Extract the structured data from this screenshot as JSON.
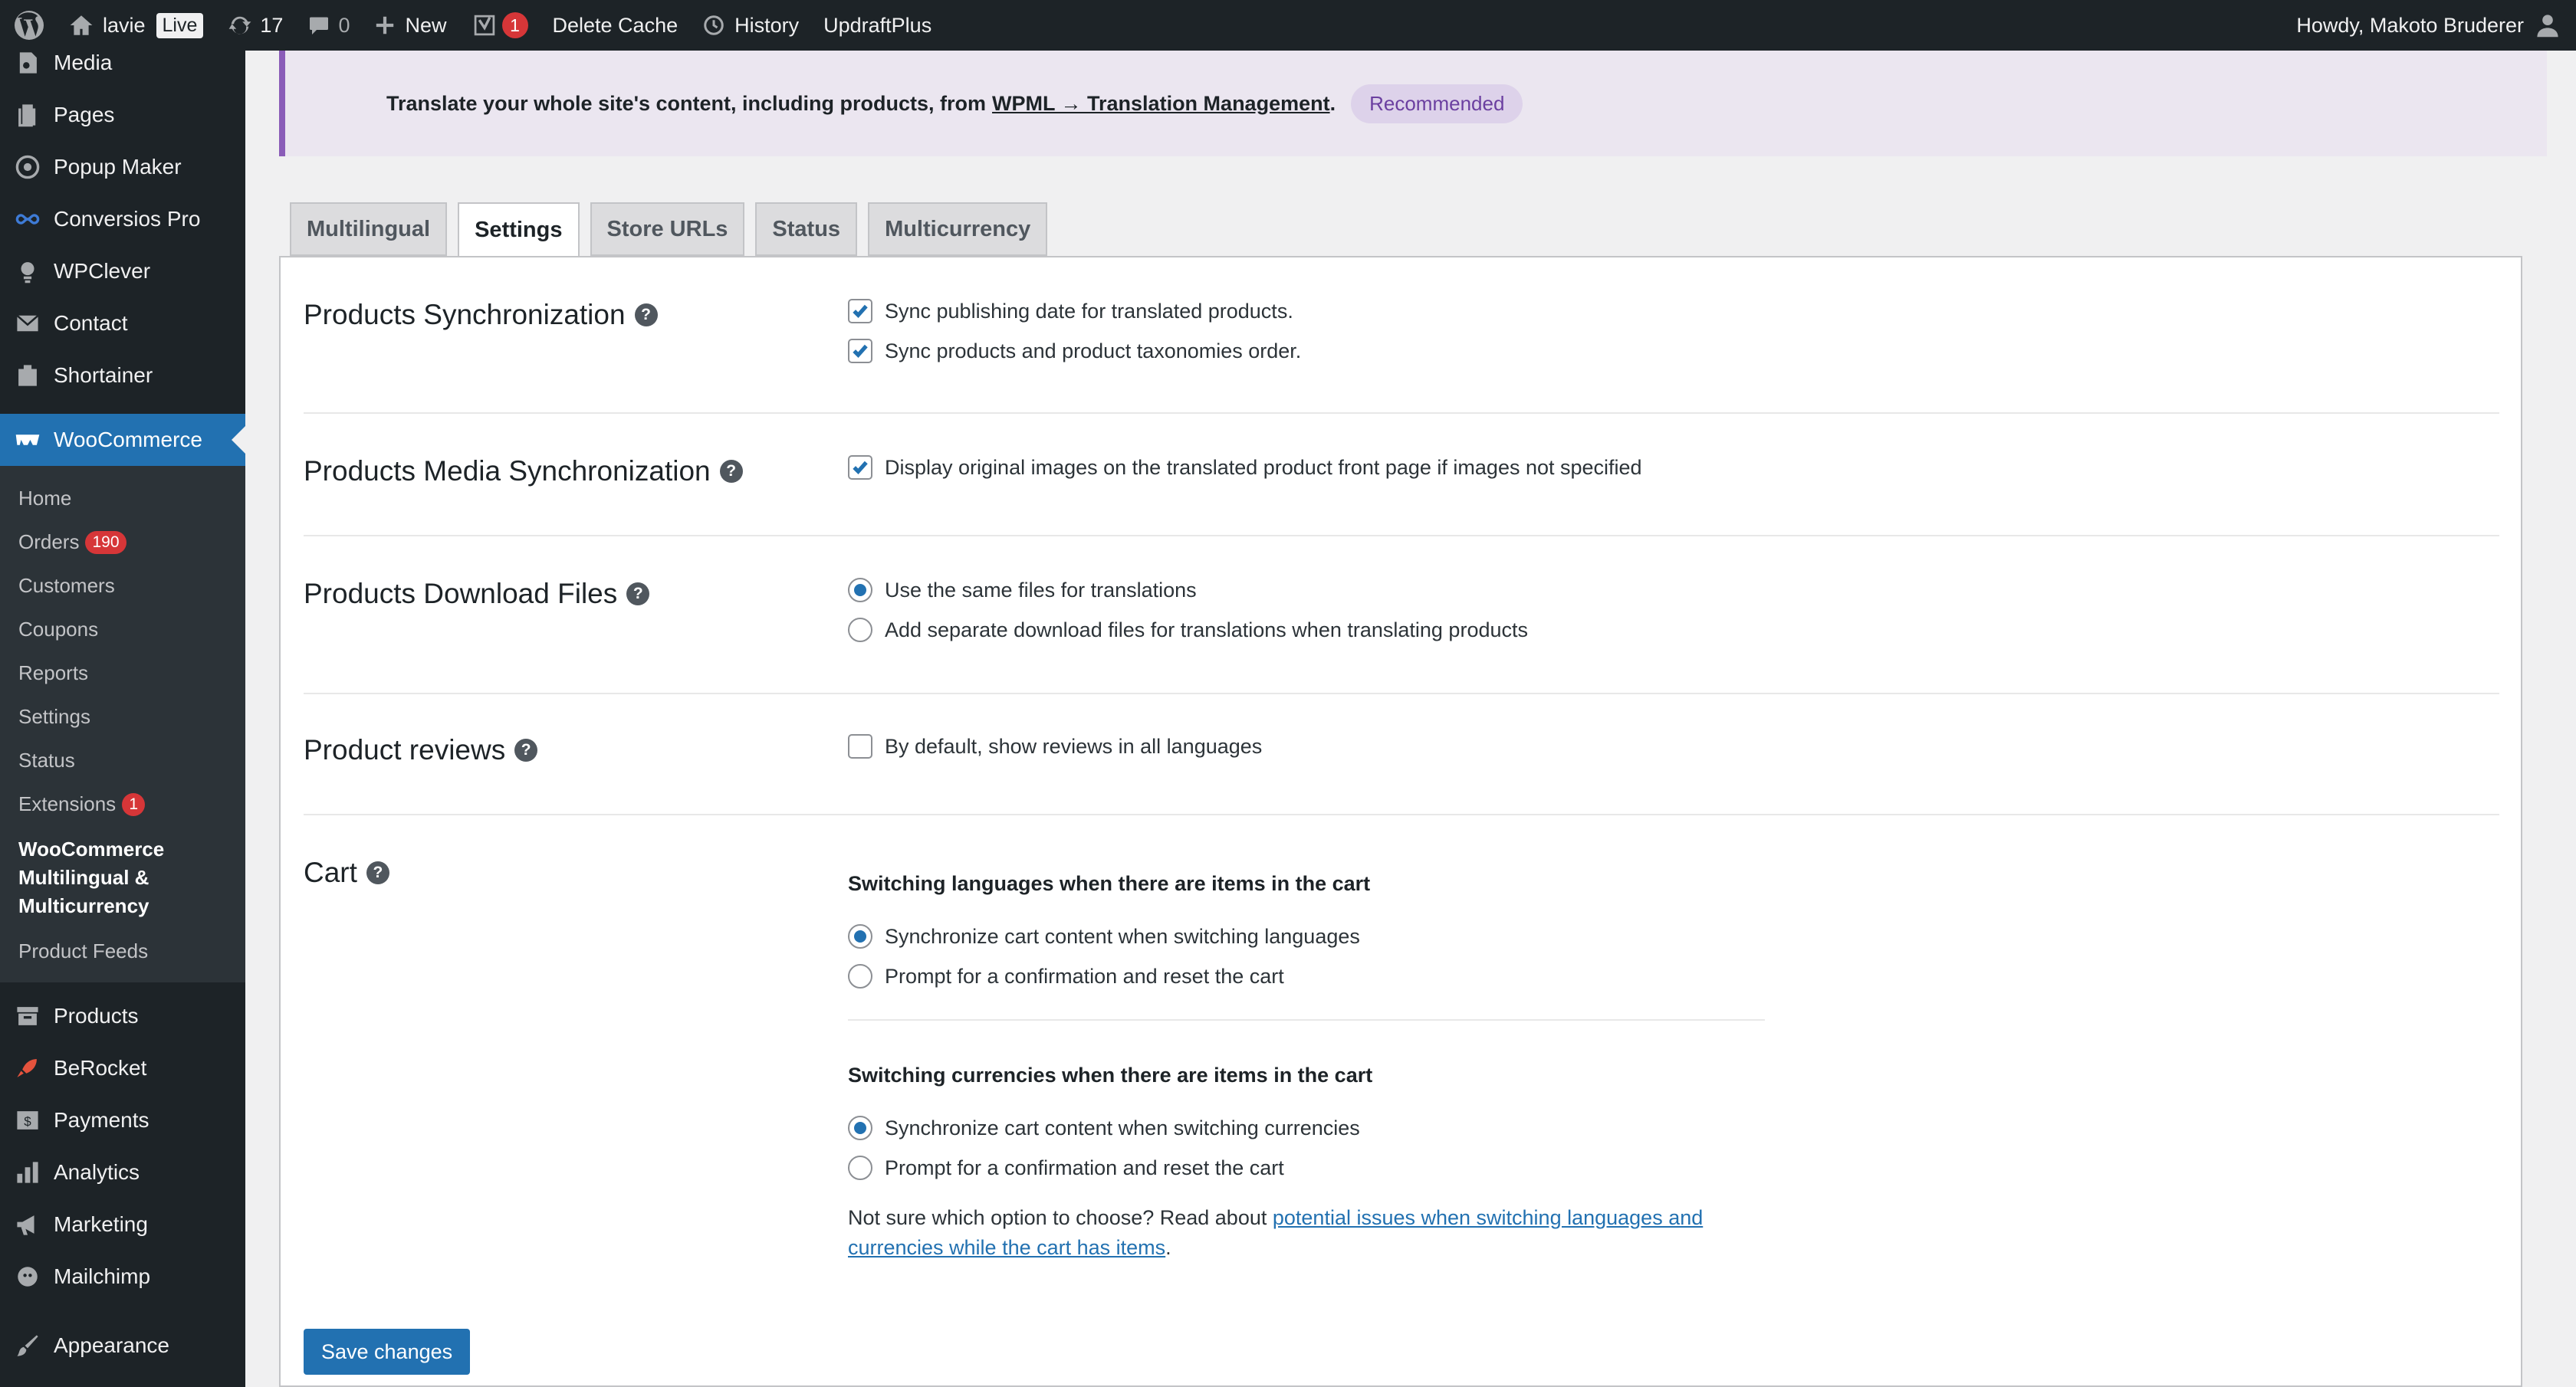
{
  "adminbar": {
    "site_name": "lavie",
    "live_label": "Live",
    "updates_count": "17",
    "comments_count": "0",
    "new_label": "New",
    "yoast_badge": "1",
    "delete_cache": "Delete Cache",
    "history": "History",
    "updraft": "UpdraftPlus",
    "howdy": "Howdy, Makoto Bruderer"
  },
  "sidebar": {
    "top_items": [
      {
        "label": "Media",
        "icon": "media-icon"
      },
      {
        "label": "Pages",
        "icon": "pages-icon"
      },
      {
        "label": "Popup Maker",
        "icon": "popup-maker-icon"
      },
      {
        "label": "Conversios Pro",
        "icon": "conversios-icon"
      },
      {
        "label": "WPClever",
        "icon": "wpclever-icon"
      },
      {
        "label": "Contact",
        "icon": "envelope-icon"
      },
      {
        "label": "Shortainer",
        "icon": "shortainer-icon"
      }
    ],
    "woocommerce": {
      "label": "WooCommerce",
      "icon": "woocommerce-icon"
    },
    "submenu": [
      {
        "label": "Home"
      },
      {
        "label": "Orders",
        "badge": "190"
      },
      {
        "label": "Customers"
      },
      {
        "label": "Coupons"
      },
      {
        "label": "Reports"
      },
      {
        "label": "Settings"
      },
      {
        "label": "Status"
      },
      {
        "label": "Extensions",
        "badge": "1"
      },
      {
        "label": "WooCommerce Multilingual & Multicurrency",
        "current": true
      },
      {
        "label": "Product Feeds"
      }
    ],
    "bottom_items": [
      {
        "label": "Products",
        "icon": "archive-icon"
      },
      {
        "label": "BeRocket",
        "icon": "rocket-icon"
      },
      {
        "label": "Payments",
        "icon": "payments-icon"
      },
      {
        "label": "Analytics",
        "icon": "bar-chart-icon"
      },
      {
        "label": "Marketing",
        "icon": "megaphone-icon"
      },
      {
        "label": "Mailchimp",
        "icon": "mailchimp-icon"
      },
      {
        "label": "Appearance",
        "icon": "paintbrush-icon"
      }
    ]
  },
  "notice": {
    "text_before": "Translate your whole site's content, including products, from",
    "link": "WPML → Translation Management",
    "text_after": ".",
    "badge": "Recommended"
  },
  "tabs": [
    "Multilingual",
    "Settings",
    "Store URLs",
    "Status",
    "Multicurrency"
  ],
  "active_tab": "Settings",
  "sections": {
    "sync": {
      "title": "Products Synchronization",
      "options": [
        {
          "label": "Sync publishing date for translated products.",
          "checked": true
        },
        {
          "label": "Sync products and product taxonomies order.",
          "checked": true
        }
      ]
    },
    "media": {
      "title": "Products Media Synchronization",
      "options": [
        {
          "label": "Display original images on the translated product front page if images not specified",
          "checked": true
        }
      ]
    },
    "download": {
      "title": "Products Download Files",
      "options": [
        {
          "label": "Use the same files for translations",
          "selected": true
        },
        {
          "label": "Add separate download files for translations when translating products",
          "selected": false
        }
      ]
    },
    "reviews": {
      "title": "Product reviews",
      "options": [
        {
          "label": "By default, show reviews in all languages",
          "checked": false
        }
      ]
    },
    "cart": {
      "title": "Cart",
      "languages_heading": "Switching languages when there are items in the cart",
      "languages_options": [
        {
          "label": "Synchronize cart content when switching languages",
          "selected": true
        },
        {
          "label": "Prompt for a confirmation and reset the cart",
          "selected": false
        }
      ],
      "currencies_heading": "Switching currencies when there are items in the cart",
      "currencies_options": [
        {
          "label": "Synchronize cart content when switching currencies",
          "selected": true
        },
        {
          "label": "Prompt for a confirmation and reset the cart",
          "selected": false
        }
      ],
      "note_before": "Not sure which option to choose? Read about",
      "note_link": "potential issues when switching languages and currencies while the cart has items",
      "note_after": "."
    }
  },
  "save_label": "Save changes",
  "colors": {
    "accent": "#2271b1",
    "adminbar": "#1d2327",
    "badge": "#d63638",
    "notice_border": "#8a5cb8"
  }
}
